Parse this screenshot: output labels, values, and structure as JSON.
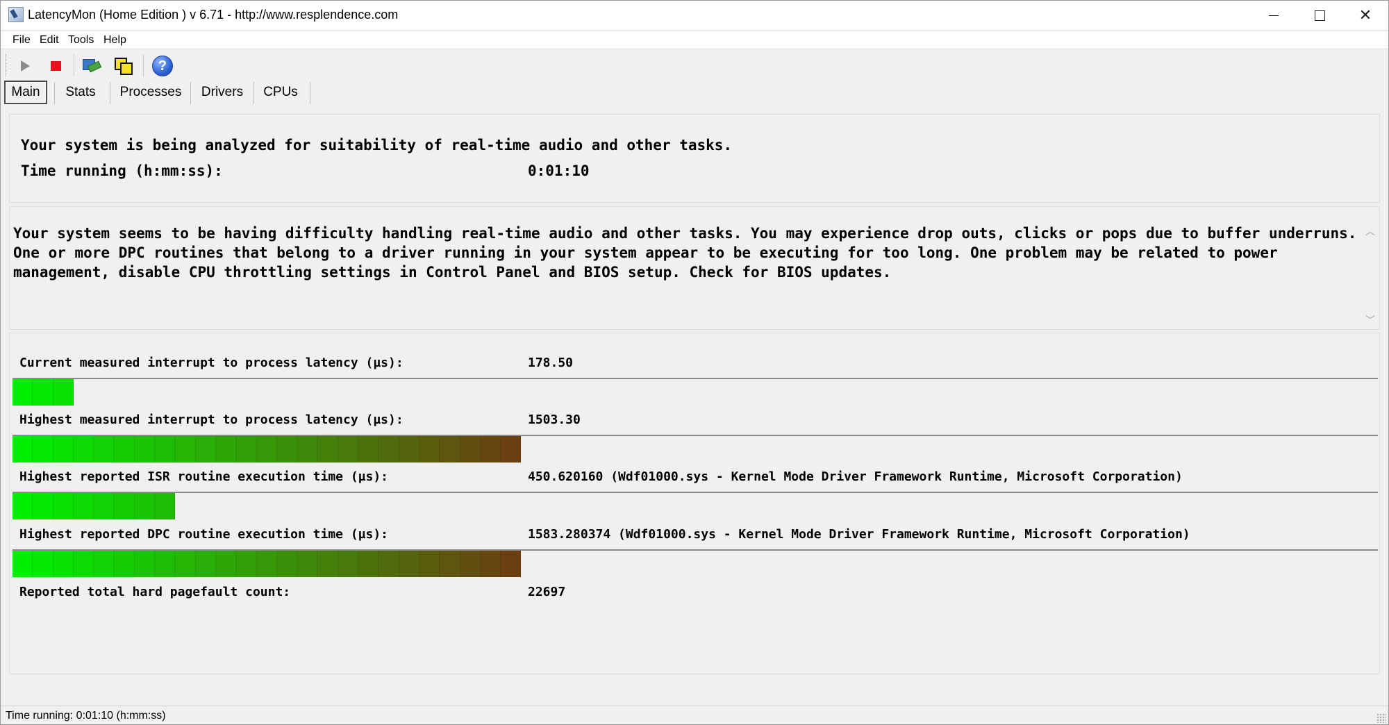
{
  "window": {
    "title": "LatencyMon  (Home Edition )  v 6.71 - http://www.resplendence.com",
    "minimize_icon": "minimize-icon",
    "maximize_icon": "maximize-icon",
    "close_label": "✕"
  },
  "menu": {
    "items": [
      "File",
      "Edit",
      "Tools",
      "Help"
    ]
  },
  "toolbar": {
    "icons": [
      "play-icon",
      "stop-icon",
      "properties-icon",
      "windows-icon",
      "help-icon"
    ],
    "help_glyph": "?"
  },
  "tabs": [
    "Main",
    "Stats",
    "Processes",
    "Drivers",
    "CPUs"
  ],
  "active_tab": "Main",
  "status": {
    "analyzing": "Your system is being analyzed for suitability of real-time audio and other tasks.",
    "time_label": "Time running (h:mm:ss):",
    "time_value": "0:01:10"
  },
  "message": {
    "text": "Your system seems to be having difficulty handling real-time audio and other tasks. You may experience drop outs, clicks or pops due to buffer underruns. One or more DPC routines that belong to a driver running in your system appear to be executing for too long. One problem may be related to power management, disable CPU throttling settings in Control Panel and BIOS setup. Check for BIOS updates.",
    "scroll_up": "︿",
    "scroll_down": "﹀"
  },
  "metrics": [
    {
      "label": "Current measured interrupt to process latency (µs):",
      "value": "178.50",
      "bar_segments": 3
    },
    {
      "label": "Highest measured interrupt to process latency (µs):",
      "value": "1503.30",
      "bar_segments": 25
    },
    {
      "label": "Highest reported ISR routine execution time (µs):",
      "value": "450.620160   (Wdf01000.sys - Kernel Mode Driver Framework Runtime, Microsoft Corporation)",
      "bar_segments": 8
    },
    {
      "label": "Highest reported DPC routine execution time (µs):",
      "value": "1583.280374  (Wdf01000.sys - Kernel Mode Driver Framework Runtime, Microsoft Corporation)",
      "bar_segments": 25
    }
  ],
  "pagefault": {
    "label": "Reported total hard pagefault count:",
    "value": "22697"
  },
  "statusbar": {
    "text": "Time running: 0:01:10  (h:mm:ss)"
  },
  "colors": {
    "bar_start": "#00f000",
    "bar_end": "#6b3f10",
    "stop_red": "#e8101a"
  }
}
